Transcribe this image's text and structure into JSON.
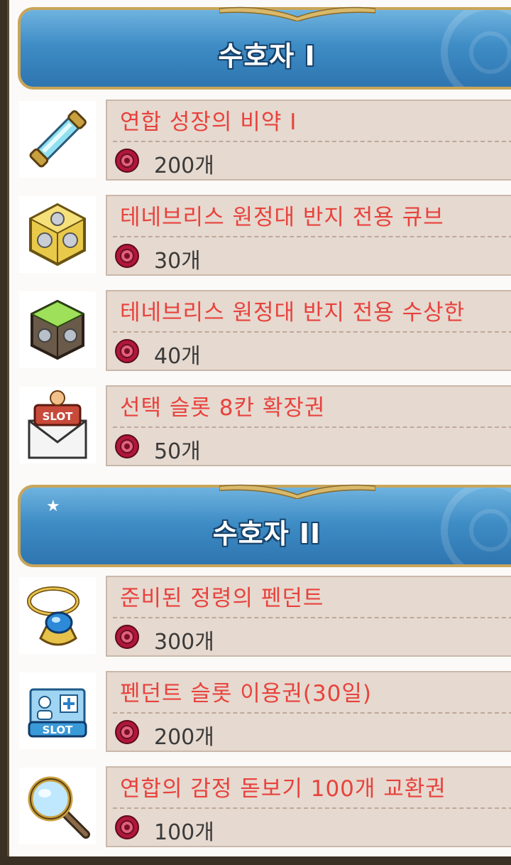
{
  "sections": [
    {
      "title": "수호자 I",
      "items": [
        {
          "name": "연합 성장의 비약 I",
          "price": "200개",
          "icon": "potion-scroll-icon"
        },
        {
          "name": "테네브리스 원정대 반지 전용 큐브",
          "price": "30개",
          "icon": "golden-cube-icon"
        },
        {
          "name": "테네브리스 원정대 반지 전용 수상한",
          "price": "40개",
          "icon": "green-cube-icon"
        },
        {
          "name": "선택 슬롯 8칸 확장권",
          "price": "50개",
          "icon": "slot-envelope-icon"
        }
      ]
    },
    {
      "title": "수호자 II",
      "items": [
        {
          "name": "준비된 정령의 펜던트",
          "price": "300개",
          "icon": "pendant-icon"
        },
        {
          "name": "펜던트 슬롯 이용권(30일)",
          "price": "200개",
          "icon": "slot-card-icon"
        },
        {
          "name": "연합의 감정 돋보기 100개 교환권",
          "price": "100개",
          "icon": "magnifier-icon"
        }
      ]
    }
  ],
  "colors": {
    "item_name": "#e8423d",
    "banner": "#3f8dc6",
    "info_bg": "#e6d9cf",
    "currency": "#b0173a"
  },
  "currency_icon": "union-coin-icon"
}
